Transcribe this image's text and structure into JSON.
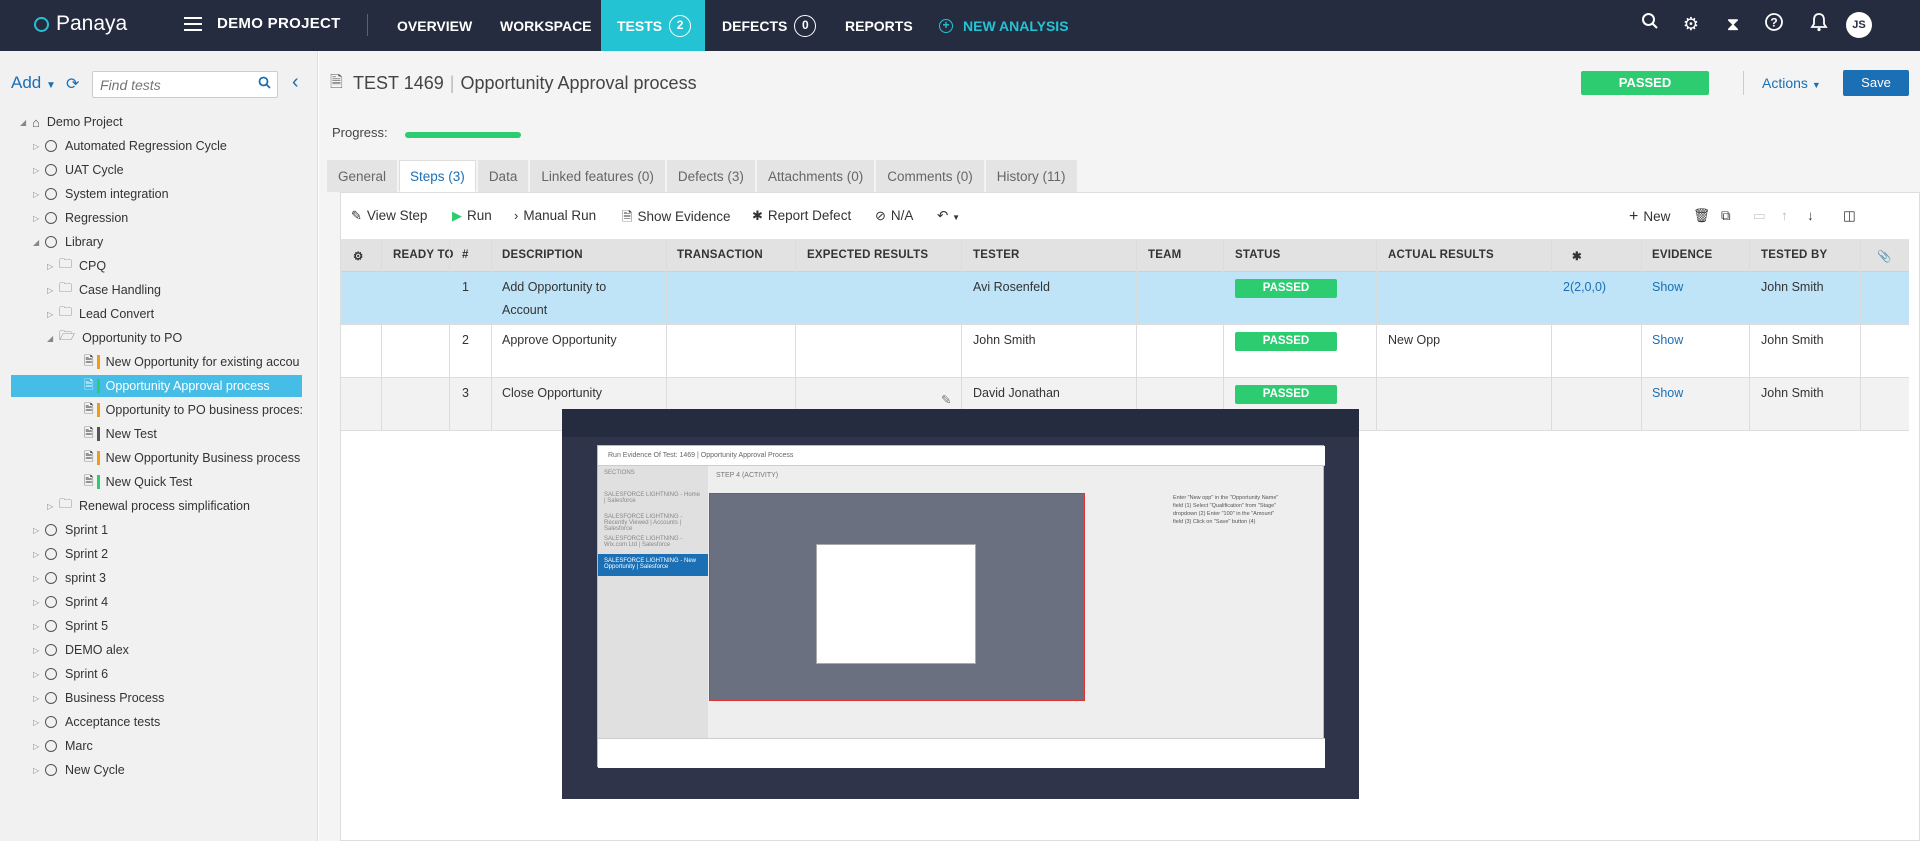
{
  "topbar": {
    "logo": "Panaya",
    "project": "DEMO PROJECT",
    "nav": [
      {
        "label": "OVERVIEW"
      },
      {
        "label": "WORKSPACE"
      },
      {
        "label": "TESTS",
        "count": "2"
      },
      {
        "label": "DEFECTS",
        "count": "0"
      },
      {
        "label": "REPORTS"
      },
      {
        "label": "NEW ANALYSIS"
      }
    ],
    "avatar": "JS",
    "colors": {
      "bar": "#262c40",
      "accent": "#23c3d3"
    }
  },
  "sidebar": {
    "add_label": "Add",
    "search_placeholder": "Find tests",
    "tree": [
      {
        "label": "Demo Project"
      },
      {
        "label": "Automated Regression Cycle"
      },
      {
        "label": "UAT Cycle"
      },
      {
        "label": "System integration"
      },
      {
        "label": "Regression"
      },
      {
        "label": "Library"
      },
      {
        "label": "CPQ"
      },
      {
        "label": "Case Handling"
      },
      {
        "label": "Lead Convert"
      },
      {
        "label": "Opportunity to PO"
      },
      {
        "label": "New Opportunity for existing accou"
      },
      {
        "label": "Opportunity Approval process"
      },
      {
        "label": "Opportunity to PO business proces:"
      },
      {
        "label": "New Test"
      },
      {
        "label": "New Opportunity Business process"
      },
      {
        "label": "New Quick Test"
      },
      {
        "label": "Renewal process simplification"
      },
      {
        "label": "Sprint 1"
      },
      {
        "label": "Sprint 2"
      },
      {
        "label": "sprint 3"
      },
      {
        "label": "Sprint 4"
      },
      {
        "label": "Sprint 5"
      },
      {
        "label": "DEMO alex"
      },
      {
        "label": "Sprint 6"
      },
      {
        "label": "Business Process"
      },
      {
        "label": "Acceptance tests"
      },
      {
        "label": "Marc"
      },
      {
        "label": "New Cycle"
      }
    ]
  },
  "header": {
    "test_label": "TEST",
    "test_id": "1469",
    "title": "Opportunity Approval process",
    "status": "PASSED",
    "actions_label": "Actions",
    "save_label": "Save",
    "progress_label": "Progress:",
    "progress_fraction": 1.0
  },
  "tabs": [
    {
      "label": "General"
    },
    {
      "label": "Steps (3)"
    },
    {
      "label": "Data"
    },
    {
      "label": "Linked features (0)"
    },
    {
      "label": "Defects (3)"
    },
    {
      "label": "Attachments (0)"
    },
    {
      "label": "Comments (0)"
    },
    {
      "label": "History (11)"
    }
  ],
  "toolbar": {
    "view_step": "View Step",
    "run": "Run",
    "manual_run": "Manual Run",
    "show_evidence": "Show Evidence",
    "report_defect": "Report Defect",
    "na": "N/A",
    "new": "New"
  },
  "grid": {
    "headers": [
      "READY TO",
      "#",
      "DESCRIPTION",
      "TRANSACTION",
      "EXPECTED RESULTS",
      "TESTER",
      "TEAM",
      "STATUS",
      "ACTUAL RESULTS",
      "EVIDENCE",
      "TESTED BY"
    ],
    "rows": [
      {
        "num": "1",
        "desc1": "Add Opportunity to",
        "desc2": "Account",
        "tester": "Avi Rosenfeld",
        "status": "PASSED",
        "actual": "",
        "defects": "2(2,0,0)",
        "evidence": "Show",
        "tested_by": "John Smith"
      },
      {
        "num": "2",
        "desc1": "Approve Opportunity",
        "desc2": "",
        "tester": "John Smith",
        "status": "PASSED",
        "actual": "New Opp",
        "defects": "",
        "evidence": "Show",
        "tested_by": "John Smith"
      },
      {
        "num": "3",
        "desc1": "Close Opportunity",
        "desc2": "",
        "tester": "David Jonathan",
        "status": "PASSED",
        "actual": "",
        "defects": "",
        "evidence": "Show",
        "tested_by": "John Smith"
      }
    ]
  },
  "evidence_preview": {
    "title": "Run Evidence Of Test: 1469 | Opportunity Approval Process",
    "sections_label": "SECTIONS",
    "step_label": "STEP 4 (ACTIVITY)",
    "sections": [
      "SALESFORCE LIGHTNING - Home | Salesforce",
      "SALESFORCE LIGHTNING - Recently Viewed | Accounts | Salesforce",
      "SALESFORCE LIGHTNING - Wix.com Ltd | Salesforce",
      "SALESFORCE LIGHTNING - New Opportunity | Salesforce"
    ],
    "note": "Enter \"New opp\" in the \"Opportunity Name\" field (1) Select \"Qualification\" from \"Stage\" dropdown (2) Enter \"100\" in the \"Amount\" field (3) Click on \"Save\" button (4)"
  }
}
